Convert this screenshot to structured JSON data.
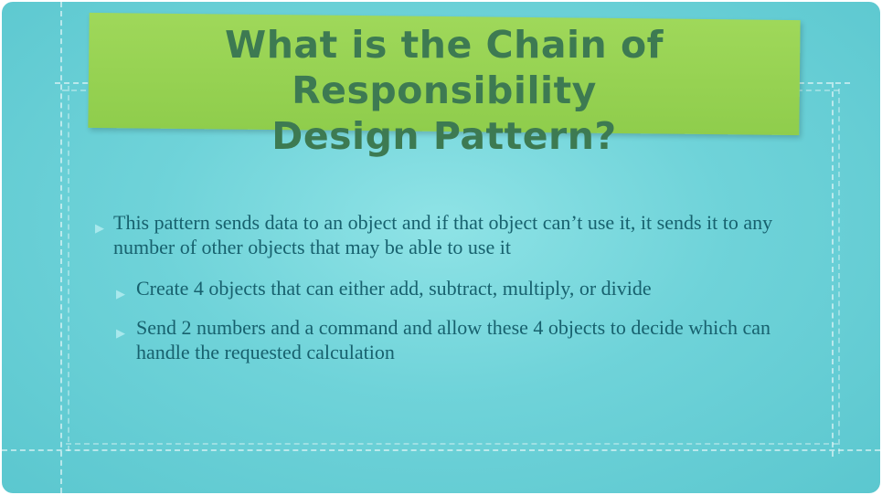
{
  "slide": {
    "title_line1": "What is the Chain of Responsibility",
    "title_line2": "Design Pattern?",
    "bullets": [
      "This pattern sends data to an object and if that object can’t use it, it sends it to any number of other objects that may be able to use it",
      "Create 4 objects that can either add, subtract, multiply, or divide",
      "Send 2 numbers and a command and allow these 4 objects to decide which can handle the requested calculation"
    ],
    "bullet_marker": "▶"
  },
  "colors": {
    "background": "#6fd3d9",
    "title_banner": "#9fd85a",
    "title_text": "#3d7a52",
    "body_text": "#17616e"
  }
}
